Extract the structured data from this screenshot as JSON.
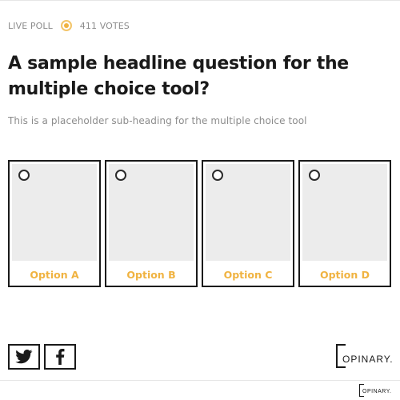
{
  "poll": {
    "live_label": "LIVE POLL",
    "votes_label": "411 VOTES",
    "headline": "A sample headline question for the multiple choice tool?",
    "subheading": "This is a placeholder sub-heading for the multiple choice tool"
  },
  "options": [
    {
      "label": "Option A"
    },
    {
      "label": "Option B"
    },
    {
      "label": "Option C"
    },
    {
      "label": "Option D"
    }
  ],
  "share": {
    "twitter_icon": "twitter-icon",
    "facebook_icon": "facebook-icon"
  },
  "branding": {
    "logo_text": "OPINARY.",
    "footer_logo_text": "OPINARY."
  },
  "colors": {
    "accent": "#f0b341",
    "text": "#1a1a1a",
    "muted": "#8c8c8c"
  }
}
